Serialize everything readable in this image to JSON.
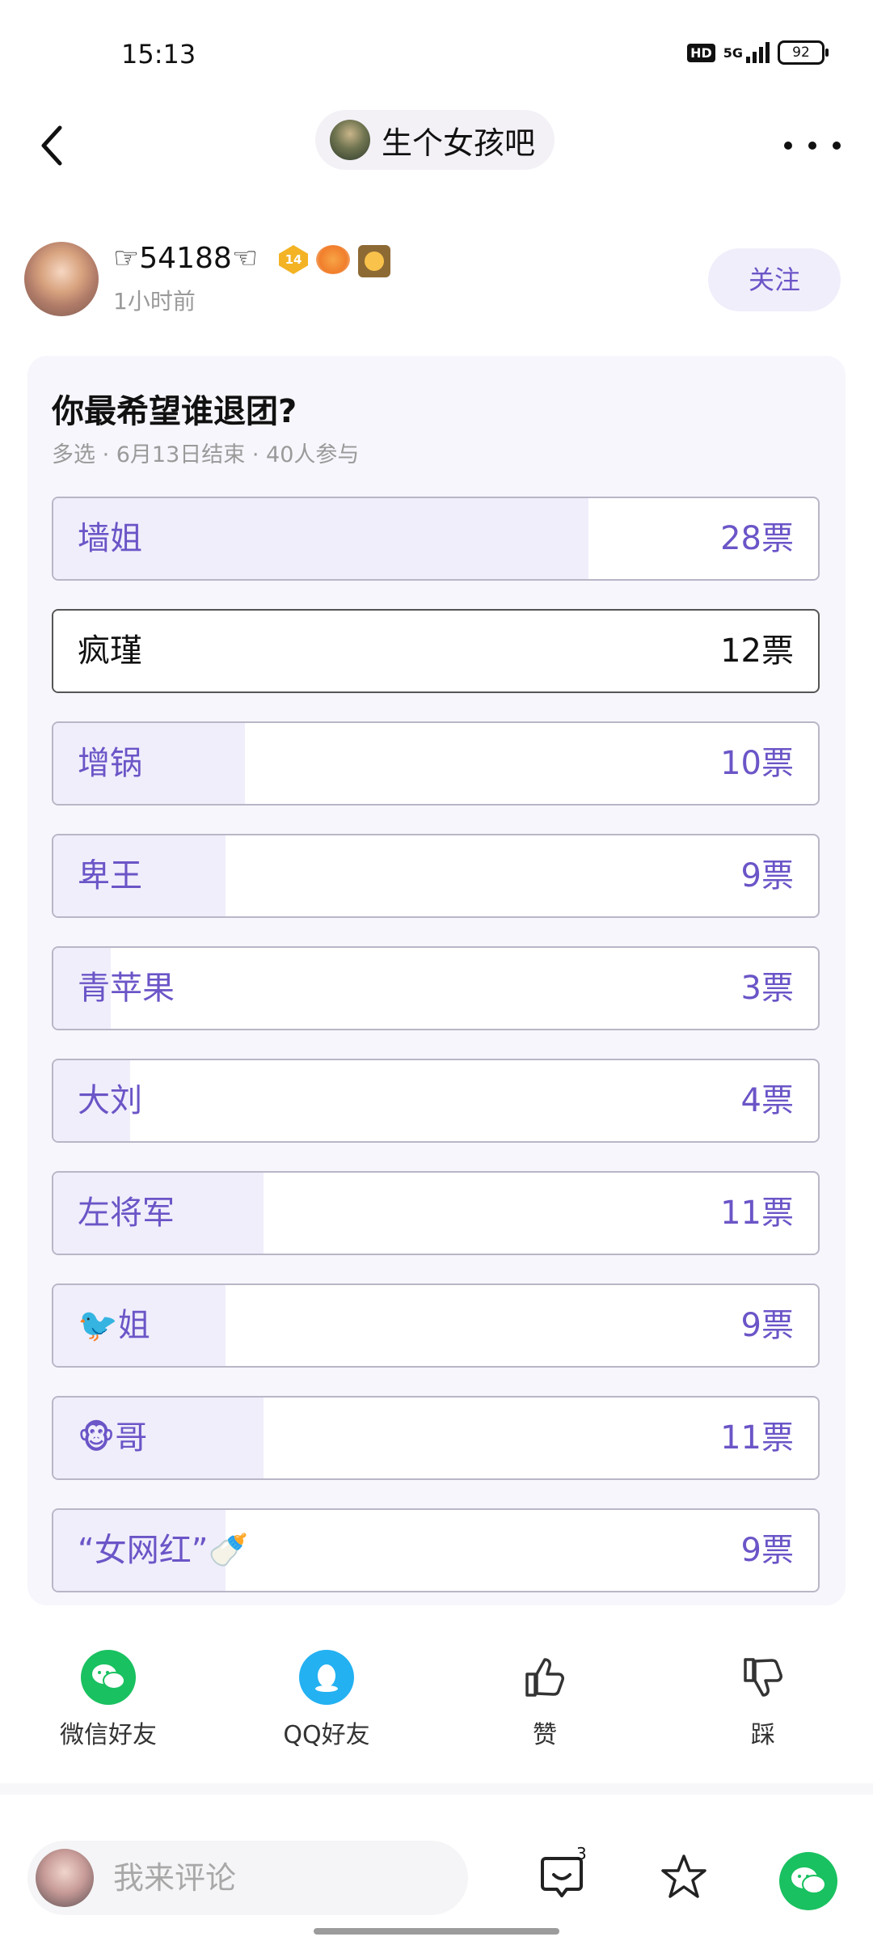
{
  "status_bar": {
    "time": "15:13",
    "network": "5G",
    "battery": "92",
    "hd_label": "HD"
  },
  "nav": {
    "forum_name": "生个女孩吧"
  },
  "author": {
    "name": "☞54188☜",
    "level": "14",
    "time": "1小时前",
    "follow_label": "关注"
  },
  "poll": {
    "title": "你最希望谁退团?",
    "meta": "多选 · 6月13日结束 · 40人参与",
    "options": [
      {
        "label": "墙姐",
        "votes": "28票",
        "count": 28,
        "selected": false
      },
      {
        "label": "疯瑾",
        "votes": "12票",
        "count": 12,
        "selected": true
      },
      {
        "label": "增锅",
        "votes": "10票",
        "count": 10,
        "selected": false
      },
      {
        "label": "卑王",
        "votes": "9票",
        "count": 9,
        "selected": false
      },
      {
        "label": "青苹果",
        "votes": "3票",
        "count": 3,
        "selected": false
      },
      {
        "label": "大刘",
        "votes": "4票",
        "count": 4,
        "selected": false
      },
      {
        "label": "左将军",
        "votes": "11票",
        "count": 11,
        "selected": false
      },
      {
        "label": "🐦姐",
        "votes": "9票",
        "count": 9,
        "selected": false
      },
      {
        "label": "🐵哥",
        "votes": "11票",
        "count": 11,
        "selected": false
      },
      {
        "label": "“女网红”🍼",
        "votes": "9票",
        "count": 9,
        "selected": false
      }
    ],
    "total_participants": 40
  },
  "share": {
    "wechat_label": "微信好友",
    "qq_label": "QQ好友",
    "like_label": "赞",
    "dislike_label": "踩"
  },
  "bottom_bar": {
    "comment_placeholder": "我来评论",
    "comment_count": "3"
  },
  "colors": {
    "accent": "#6b55c7",
    "wechat_green": "#19c160",
    "qq_blue": "#23b1f2"
  }
}
